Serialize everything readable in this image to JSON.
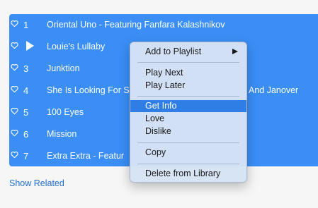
{
  "tracks": [
    {
      "number": "1",
      "title": "Oriental Uno - Featuring Fanfara Kalashnikov",
      "suffix": "",
      "playing": false
    },
    {
      "number": "",
      "title": "Louie's Lullaby",
      "suffix": "",
      "playing": true
    },
    {
      "number": "3",
      "title": "Junktion",
      "suffix": "",
      "playing": false
    },
    {
      "number": "4",
      "title": "She Is Looking For S",
      "suffix": "And Janover",
      "playing": false
    },
    {
      "number": "5",
      "title": "100 Eyes",
      "suffix": "",
      "playing": false
    },
    {
      "number": "6",
      "title": "Mission",
      "suffix": "",
      "playing": false
    },
    {
      "number": "7",
      "title": "Extra Extra - Featur",
      "suffix": "",
      "playing": false
    }
  ],
  "show_related": "Show Related",
  "context_menu": {
    "add_to_playlist": "Add to Playlist",
    "play_next": "Play Next",
    "play_later": "Play Later",
    "get_info": "Get Info",
    "love": "Love",
    "dislike": "Dislike",
    "copy": "Copy",
    "delete_from_library": "Delete from Library",
    "highlighted_item": "Get Info"
  },
  "colors": {
    "selection": "#3a8ef6",
    "menu_highlight": "#2f7ee6",
    "link": "#1f6fd0"
  },
  "icons": {
    "love": "heart-outline-icon",
    "now_playing": "play-icon",
    "submenu": "chevron-right-icon"
  }
}
